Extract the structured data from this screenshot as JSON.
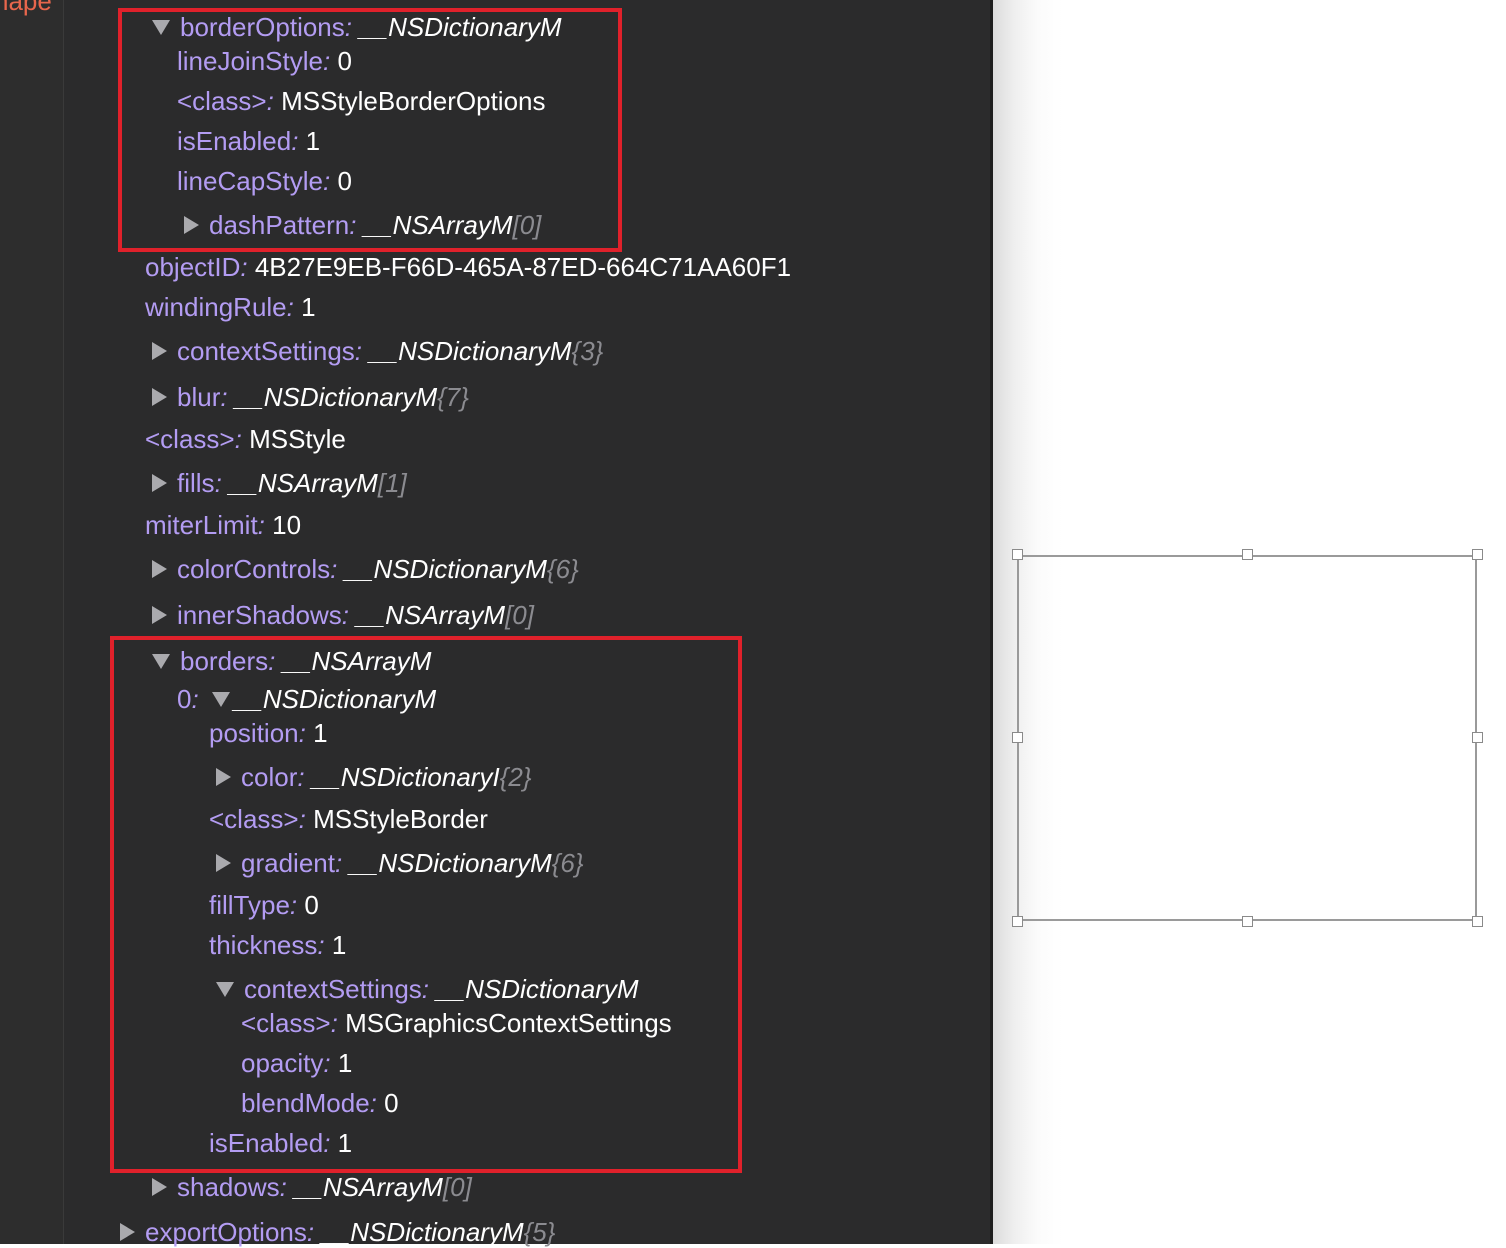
{
  "gutter": {
    "label": "hape"
  },
  "rows": [
    {
      "expander": "down",
      "key": "borderOptions",
      "type": "__NSDictionaryM"
    },
    {
      "key": "lineJoinStyle",
      "value": "0"
    },
    {
      "key": "<class>",
      "value": "MSStyleBorderOptions"
    },
    {
      "key": "isEnabled",
      "value": "1"
    },
    {
      "key": "lineCapStyle",
      "value": "0"
    },
    {
      "expander": "right",
      "key": "dashPattern",
      "type": "__NSArrayM",
      "count": "[0]"
    },
    {
      "key": "objectID",
      "value": "4B27E9EB-F66D-465A-87ED-664C71AA60F1"
    },
    {
      "key": "windingRule",
      "value": "1"
    },
    {
      "expander": "right",
      "key": "contextSettings",
      "type": "__NSDictionaryM",
      "count": "{3}"
    },
    {
      "expander": "right",
      "key": "blur",
      "type": "__NSDictionaryM",
      "count": "{7}"
    },
    {
      "key": "<class>",
      "value": "MSStyle"
    },
    {
      "expander": "right",
      "key": "fills",
      "type": "__NSArrayM",
      "count": "[1]"
    },
    {
      "key": "miterLimit",
      "value": "10"
    },
    {
      "expander": "right",
      "key": "colorControls",
      "type": "__NSDictionaryM",
      "count": "{6}"
    },
    {
      "expander": "right",
      "key": "innerShadows",
      "type": "__NSArrayM",
      "count": "[0]"
    },
    {
      "expander": "down",
      "key": "borders",
      "type": "__NSArrayM"
    },
    {
      "key": "0",
      "inline_expander": "down",
      "type": "__NSDictionaryM"
    },
    {
      "key": "position",
      "value": "1"
    },
    {
      "expander": "right",
      "key": "color",
      "type": "__NSDictionaryI",
      "count": "{2}"
    },
    {
      "key": "<class>",
      "value": "MSStyleBorder"
    },
    {
      "expander": "right",
      "key": "gradient",
      "type": "__NSDictionaryM",
      "count": "{6}"
    },
    {
      "key": "fillType",
      "value": "0"
    },
    {
      "key": "thickness",
      "value": "1"
    },
    {
      "expander": "down",
      "key": "contextSettings",
      "type": "__NSDictionaryM"
    },
    {
      "key": "<class>",
      "value": "MSGraphicsContextSettings"
    },
    {
      "key": "opacity",
      "value": "1"
    },
    {
      "key": "blendMode",
      "value": "0"
    },
    {
      "key": "isEnabled",
      "value": "1"
    },
    {
      "expander": "right",
      "key": "shadows",
      "type": "__NSArrayM",
      "count": "[0]"
    },
    {
      "expander": "right",
      "key": "exportOptions",
      "type": "__NSDictionaryM",
      "count": "{5}"
    }
  ],
  "colors": {
    "panel_background": "#2b2b2c",
    "key_color": "#b39cf2",
    "value_color": "#ffffff",
    "count_color": "#8b8b90",
    "highlight_box": "#e0212b"
  }
}
